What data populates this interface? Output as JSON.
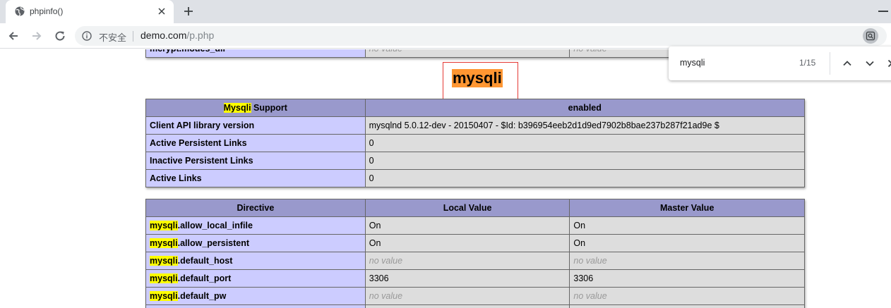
{
  "browser": {
    "tab_title": "phpinfo()",
    "security_label": "不安全",
    "url_host": "demo.com",
    "url_path": "/p.php"
  },
  "find_bar": {
    "query": "mysqli",
    "count": "1/15"
  },
  "prev_table": {
    "row": {
      "name": "mcrypt.modes_dir",
      "local": "no value",
      "master": "no value"
    }
  },
  "section_title": "mysqli",
  "support_table": {
    "header_hl": "Mysqli",
    "header_rest": " Support",
    "header_value": "enabled",
    "rows": [
      {
        "name": "Client API library version",
        "value": "mysqlnd 5.0.12-dev - 20150407 - $Id: b396954eeb2d1d9ed7902b8bae237b287f21ad9e $"
      },
      {
        "name": "Active Persistent Links",
        "value": "0"
      },
      {
        "name": "Inactive Persistent Links",
        "value": "0"
      },
      {
        "name": "Active Links",
        "value": "0"
      }
    ]
  },
  "directive_table": {
    "headers": [
      "Directive",
      "Local Value",
      "Master Value"
    ],
    "rows": [
      {
        "prefix": "mysqli",
        "suffix": ".allow_local_infile",
        "local": "On",
        "master": "On"
      },
      {
        "prefix": "mysqli",
        "suffix": ".allow_persistent",
        "local": "On",
        "master": "On"
      },
      {
        "prefix": "mysqli",
        "suffix": ".default_host",
        "local": "no value",
        "master": "no value"
      },
      {
        "prefix": "mysqli",
        "suffix": ".default_port",
        "local": "3306",
        "master": "3306"
      },
      {
        "prefix": "mysqli",
        "suffix": ".default_pw",
        "local": "no value",
        "master": "no value"
      }
    ]
  },
  "colors": {
    "header_bg": "#9999cc",
    "name_bg": "#ccccff",
    "value_bg": "#dddddd",
    "find_highlight": "#ffff00",
    "active_match": "#ff9632"
  }
}
